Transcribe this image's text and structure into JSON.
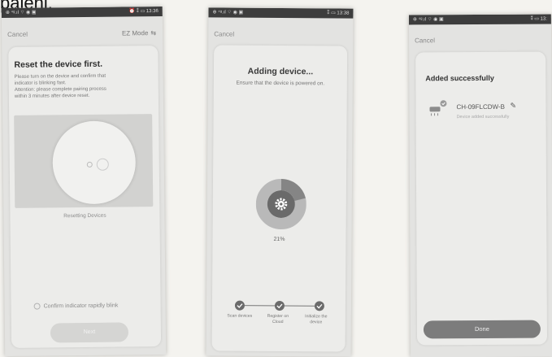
{
  "caption": "pajeni.",
  "colors": {
    "status_bar": "#3d3d3d",
    "card_bg": "#ececea",
    "progress_ring": "#858585",
    "progress_track": "#b9b9b9",
    "done_button": "#7c7c7c"
  },
  "screen1": {
    "status_left": "⊕ ⁴ᵍ.ıl ⌔ ◉ ▣",
    "status_right": "⏰ ⁑ ▭ 13:36",
    "cancel": "Cancel",
    "mode": "EZ Mode",
    "mode_icon": "switch-icon",
    "title": "Reset the device first.",
    "desc_lines": [
      "Please turn on the device and confirm that",
      "indicator is blinking fast.",
      "Attention: please complete pairing process",
      "within 3 minutes after device reset."
    ],
    "resetting": "Resetting Devices",
    "confirm": "Confirm indicator rapidly blink",
    "next": "Next"
  },
  "screen2": {
    "status_left": "⊕ ⁴ᵍ.ıl ⌔ ◉ ▣",
    "status_right": "⁑ ▭ 13:38",
    "cancel": "Cancel",
    "title": "Adding device...",
    "subtitle": "Ensure that the device is powered on.",
    "progress": 0.21,
    "percent": "21%",
    "steps": [
      {
        "label": "Scan devices"
      },
      {
        "label": "Register on Cloud"
      },
      {
        "label": "Initialize the device"
      }
    ]
  },
  "screen3": {
    "status_left": "⊕ ⁴ᵍ.ıl ⌔ ◉ ▣",
    "status_right": "⁑ ▭ 13:",
    "cancel": "Cancel",
    "title": "Added successfully",
    "device_name": "CH-09FLCDW-B",
    "message": "Device added successfully",
    "done": "Done"
  }
}
